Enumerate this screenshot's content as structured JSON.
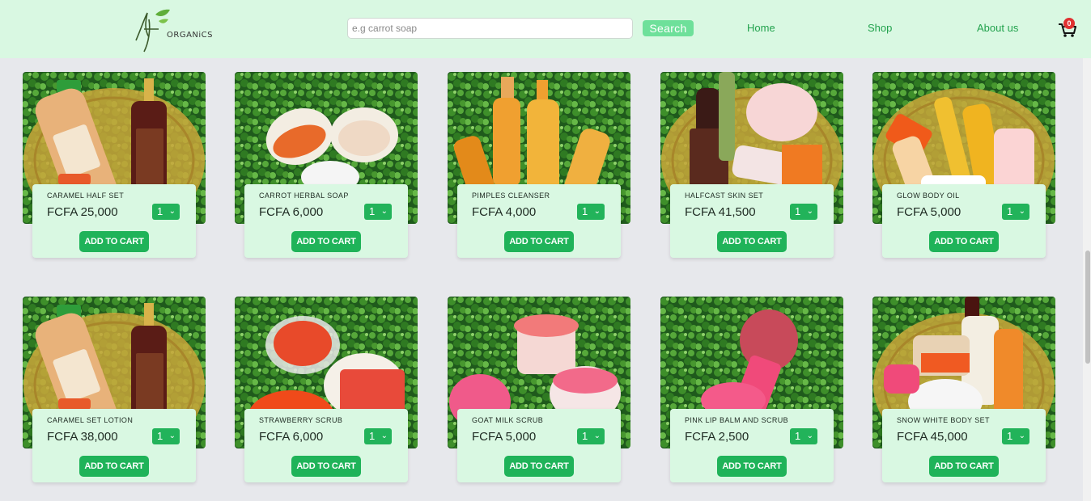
{
  "header": {
    "logo_text": "ORGANiCS",
    "logo_letters": "Nf",
    "search_placeholder": "e.g carrot soap",
    "search_button": "Search",
    "nav": [
      "Home",
      "Shop",
      "About us"
    ],
    "cart_count": "0"
  },
  "products": [
    {
      "name": "CARAMEL HALF SET",
      "price": "FCFA 25,000",
      "qty": "1",
      "add": "ADD TO CART",
      "theme": "caramel"
    },
    {
      "name": "CARROT HERBAL SOAP",
      "price": "FCFA 6,000",
      "qty": "1",
      "add": "ADD TO CART",
      "theme": "carrot"
    },
    {
      "name": "PIMPLES CLEANSER",
      "price": "FCFA 4,000",
      "qty": "1",
      "add": "ADD TO CART",
      "theme": "pimples"
    },
    {
      "name": "HALFCAST SKIN SET",
      "price": "FCFA 41,500",
      "qty": "1",
      "add": "ADD TO CART",
      "theme": "halfcast"
    },
    {
      "name": "GLOW BODY OIL",
      "price": "FCFA 5,000",
      "qty": "1",
      "add": "ADD TO CART",
      "theme": "glow"
    },
    {
      "name": "CARAMEL SET LOTION",
      "price": "FCFA 38,000",
      "qty": "1",
      "add": "ADD TO CART",
      "theme": "caramel"
    },
    {
      "name": "STRAWBERRY SCRUB",
      "price": "FCFA 6,000",
      "qty": "1",
      "add": "ADD TO CART",
      "theme": "strawberry"
    },
    {
      "name": "GOAT MILK SCRUB",
      "price": "FCFA 5,000",
      "qty": "1",
      "add": "ADD TO CART",
      "theme": "goatmilk"
    },
    {
      "name": "PINK LIP BALM AND SCRUB",
      "price": "FCFA 2,500",
      "qty": "1",
      "add": "ADD TO CART",
      "theme": "pinklip"
    },
    {
      "name": "SNOW WHITE BODY SET",
      "price": "FCFA 45,000",
      "qty": "1",
      "add": "ADD TO CART",
      "theme": "snow"
    }
  ],
  "colors": {
    "header_bg": "#d9f8e2",
    "accent": "#1fb359",
    "nav": "#22a24d",
    "badge": "#e03131",
    "page_bg": "#e7e8ec"
  },
  "icons": {
    "cart": "cart-icon",
    "chevron": "chevron-down-icon",
    "logo": "leaf-logo-icon"
  }
}
